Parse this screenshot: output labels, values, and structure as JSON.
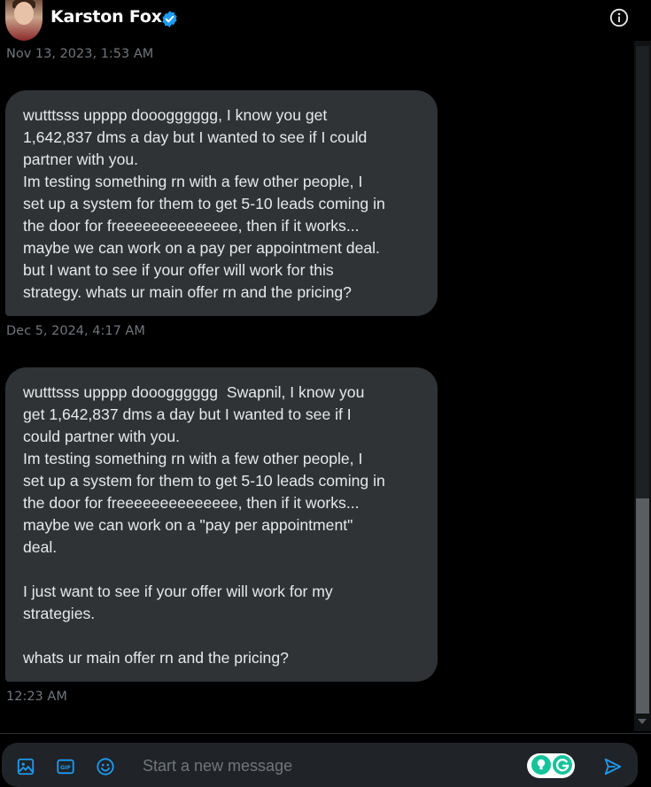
{
  "header": {
    "name": "Karston Fox",
    "verified_icon": "verified-badge-icon",
    "info_icon": "info-icon"
  },
  "messages": [
    {
      "timestamp": "Nov 13, 2023, 1:53 AM",
      "text": "wutttsss upppp dooogggggg, I know you get\n1,642,837 dms a day but I wanted to see if I could\npartner with you.\nIm testing something rn with a few other people, I\nset up a system for them to get 5-10 leads coming in\nthe door for freeeeeeeeeeeeee, then if it works...\nmaybe we can work on a pay per appointment deal.\nbut I want to see if your offer will work for this\nstrategy. whats ur main offer rn and the pricing?"
    },
    {
      "timestamp": "Dec 5, 2024, 4:17 AM",
      "text": "wutttsss upppp dooogggggg  Swapnil, I know you\nget 1,642,837 dms a day but I wanted to see if I\ncould partner with you.\nIm testing something rn with a few other people, I\nset up a system for them to get 5-10 leads coming in\nthe door for freeeeeeeeeeeeee, then if it works...\nmaybe we can work on a \"pay per appointment\"\ndeal.\n\nI just want to see if your offer will work for my\nstrategies.\n\nwhats ur main offer rn and the pricing?"
    }
  ],
  "last_timestamp": "12:23 AM",
  "composer": {
    "placeholder": "Start a new message",
    "icons": [
      "image-icon",
      "gif-icon",
      "emoji-icon",
      "grammarly-icon",
      "send-icon"
    ]
  },
  "colors": {
    "background": "#000000",
    "bubble": "#2f3336",
    "accent": "#1d9bf0",
    "muted": "#71767b"
  }
}
